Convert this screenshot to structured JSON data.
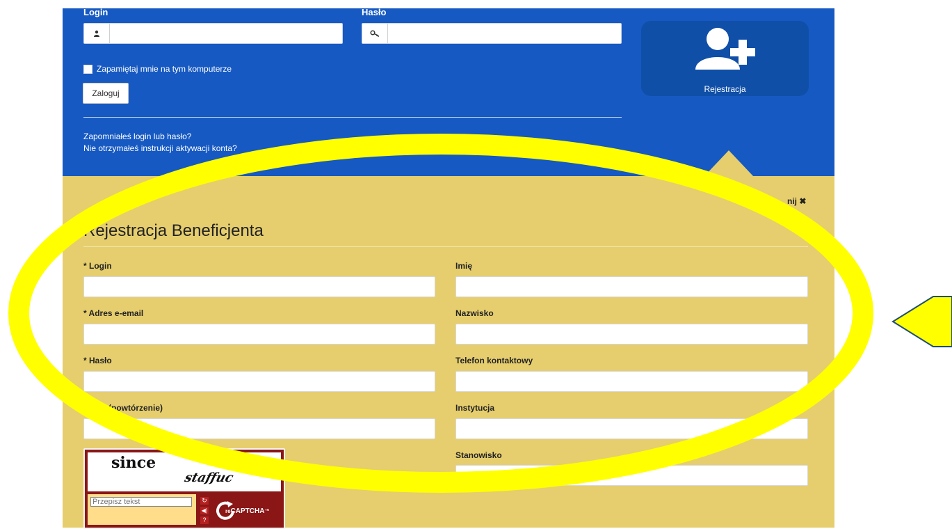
{
  "login": {
    "login_label": "Login",
    "password_label": "Hasło",
    "remember_label": "Zapamiętaj mnie na tym komputerze",
    "submit_label": "Zaloguj",
    "forgot_link": "Zapomniałeś login lub hasło?",
    "activation_link": "Nie otrzymałeś instrukcji aktywacji konta?"
  },
  "register_tile": {
    "label": "Rejestracja"
  },
  "registration": {
    "close_label_partial": "nij",
    "title": "Rejestracja Beneficjenta",
    "fields_left": [
      {
        "label": "* Login"
      },
      {
        "label": "* Adres e-email"
      },
      {
        "label": "* Hasło"
      },
      {
        "label": "Hasło (powtórzenie)"
      }
    ],
    "fields_right": [
      {
        "label": "Imię"
      },
      {
        "label": "Nazwisko"
      },
      {
        "label": "Telefon kontaktowy"
      },
      {
        "label": "Instytucja"
      },
      {
        "label": "Stanowisko"
      }
    ],
    "captcha": {
      "word1": "since",
      "word2": "staffuc",
      "placeholder": "Przepisz tekst",
      "brand": "reCAPTCHA",
      "brand_prefix": "re",
      "brand_main": "CAPTCHA",
      "tm": "™"
    }
  },
  "annotation_colors": {
    "highlight": "#ffff00",
    "outline": "#1f4e79"
  }
}
